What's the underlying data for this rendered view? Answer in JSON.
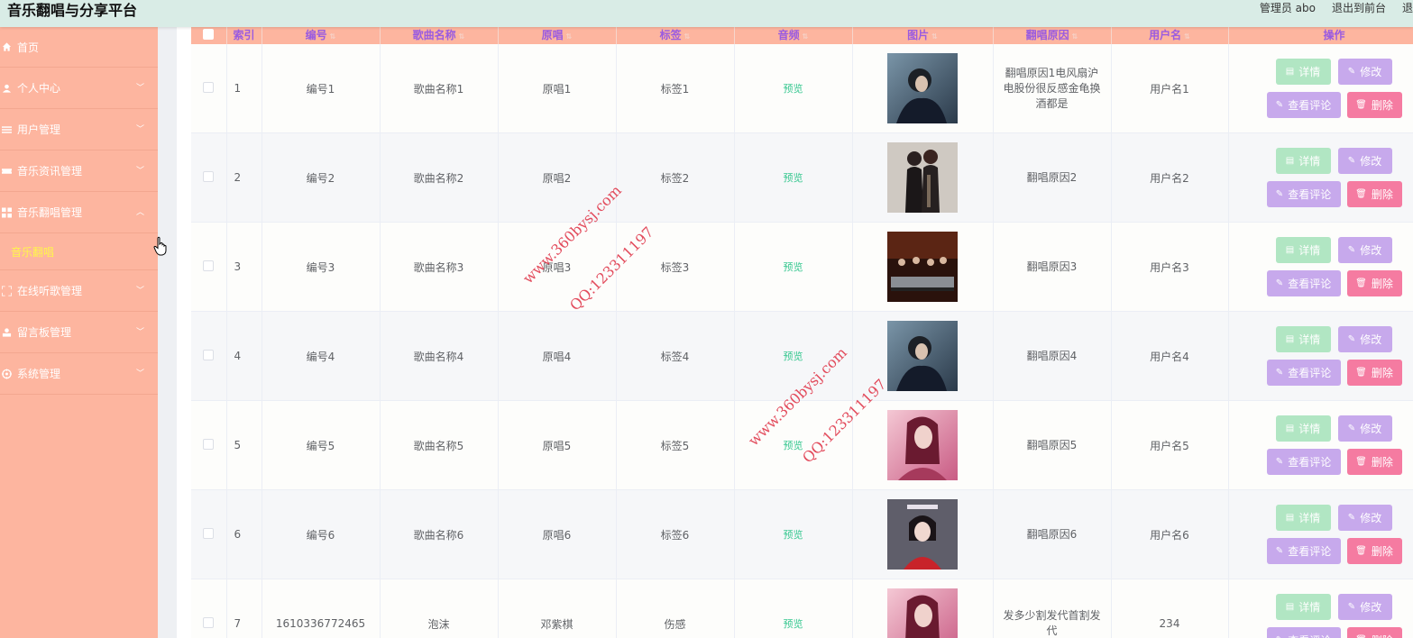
{
  "header": {
    "title": "音乐翻唱与分享平台",
    "admin": "管理员 abo",
    "back_front": "退出到前台",
    "logout": "退"
  },
  "sidebar": {
    "items": [
      {
        "label": "首页",
        "icon": "home-icon",
        "chevron": ""
      },
      {
        "label": "个人中心",
        "icon": "user-icon",
        "chevron": "chevron-down"
      },
      {
        "label": "用户管理",
        "icon": "list-icon",
        "chevron": "chevron-down"
      },
      {
        "label": "音乐资讯管理",
        "icon": "ticket-icon",
        "chevron": "chevron-down"
      },
      {
        "label": "音乐翻唱管理",
        "icon": "grid-icon",
        "chevron": "chevron-up"
      },
      {
        "label": "在线听歌管理",
        "icon": "fullscreen-icon",
        "chevron": "chevron-down"
      },
      {
        "label": "留言板管理",
        "icon": "person-icon",
        "chevron": "chevron-down"
      },
      {
        "label": "系统管理",
        "icon": "settings-icon",
        "chevron": "chevron-down"
      }
    ],
    "submenu_active": "音乐翻唱"
  },
  "table": {
    "headers": {
      "index": "索引",
      "code": "编号",
      "song": "歌曲名称",
      "original": "原唱",
      "tag": "标签",
      "audio": "音频",
      "image": "图片",
      "reason": "翻唱原因",
      "username": "用户名",
      "actions": "操作"
    },
    "rows": [
      {
        "index": "1",
        "code": "编号1",
        "song": "歌曲名称1",
        "original": "原唱1",
        "tag": "标签1",
        "audio": "预览",
        "reason": "翻唱原因1电风扇沪电股份很反感金龟换酒都是",
        "username": "用户名1",
        "image_kind": "man-portrait"
      },
      {
        "index": "2",
        "code": "编号2",
        "song": "歌曲名称2",
        "original": "原唱2",
        "tag": "标签2",
        "audio": "预览",
        "reason": "翻唱原因2",
        "username": "用户名2",
        "image_kind": "couple-guitar"
      },
      {
        "index": "3",
        "code": "编号3",
        "song": "歌曲名称3",
        "original": "原唱3",
        "tag": "标签3",
        "audio": "预览",
        "reason": "翻唱原因3",
        "username": "用户名3",
        "image_kind": "drum-band"
      },
      {
        "index": "4",
        "code": "编号4",
        "song": "歌曲名称4",
        "original": "原唱4",
        "tag": "标签4",
        "audio": "预览",
        "reason": "翻唱原因4",
        "username": "用户名4",
        "image_kind": "man-portrait"
      },
      {
        "index": "5",
        "code": "编号5",
        "song": "歌曲名称5",
        "original": "原唱5",
        "tag": "标签5",
        "audio": "预览",
        "reason": "翻唱原因5",
        "username": "用户名5",
        "image_kind": "woman-pink"
      },
      {
        "index": "6",
        "code": "编号6",
        "song": "歌曲名称6",
        "original": "原唱6",
        "tag": "标签6",
        "audio": "预览",
        "reason": "翻唱原因6",
        "username": "用户名6",
        "image_kind": "woman-red"
      },
      {
        "index": "7",
        "code": "1610336772465",
        "song": "泡沫",
        "original": "邓紫棋",
        "tag": "伤感",
        "audio": "预览",
        "reason": "发多少割发代首割发代",
        "username": "234",
        "image_kind": "woman-pink"
      }
    ],
    "buttons": {
      "detail": "详情",
      "edit": "修改",
      "comment": "查看评论",
      "delete": "删除"
    }
  },
  "watermark": {
    "site": "www.360bysj.com",
    "qq": "QQ:123311197"
  },
  "colors": {
    "sidebar": "#fdb59f",
    "header": "#d9ece6",
    "header_text": "#9a5be0",
    "detail_button": "#b1e6c3",
    "edit_button": "#c7a9ec",
    "delete_button": "#f57ba1",
    "active_submenu": "#fff64b",
    "audio_link": "#35c78f"
  }
}
